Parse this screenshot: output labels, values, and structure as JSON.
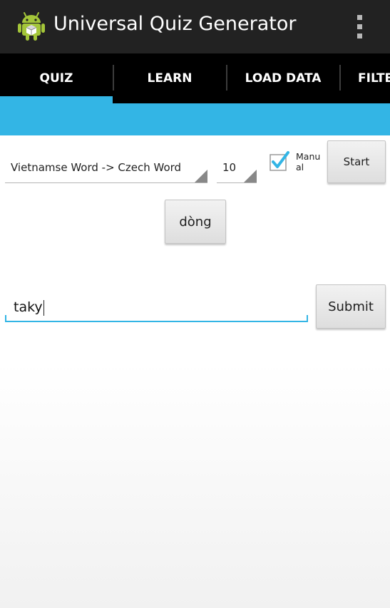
{
  "app": {
    "title": "Universal Quiz Generator",
    "icon": "android-robot-icon",
    "overflow_icon": "overflow-menu-icon"
  },
  "tabs": [
    {
      "label": "QUIZ",
      "selected": true
    },
    {
      "label": "LEARN",
      "selected": false
    },
    {
      "label": "LOAD DATA",
      "selected": false
    },
    {
      "label": "FILTE",
      "selected": false
    }
  ],
  "quiz": {
    "direction_spinner": {
      "selected": "Vietnamse Word -> Czech Word"
    },
    "count_spinner": {
      "selected": "10"
    },
    "manual_checkbox": {
      "label": "Manual",
      "checked": true
    },
    "start_button": "Start",
    "question_button": "dòng",
    "answer_input": {
      "value": "taky"
    },
    "submit_button": "Submit"
  },
  "colors": {
    "accent": "#33b5e5",
    "actionbar": "#222222",
    "tabbar": "#000000",
    "android_green": "#a4c639"
  }
}
